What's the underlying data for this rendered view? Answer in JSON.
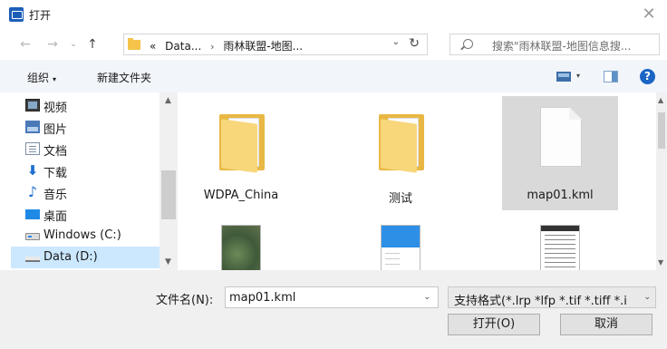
{
  "window": {
    "title": "打开",
    "icon": "app-dialog-icon",
    "close_label": "✕"
  },
  "nav": {
    "back_label": "←",
    "forward_label": "→",
    "history_label": "⌄",
    "up_label": "↑"
  },
  "address": {
    "prefix": "«",
    "crumb1": "Data...",
    "separator": "›",
    "crumb2": "雨林联盟-地图...",
    "dropdown_label": "⌄",
    "refresh_label": "↻"
  },
  "search": {
    "placeholder": "搜索\"雨林联盟-地图信息搜..."
  },
  "toolbar": {
    "organize_label": "组织",
    "organize_caret": "▾",
    "new_folder_label": "新建文件夹",
    "view_caret": "▾",
    "help_label": "?"
  },
  "sidebar": {
    "items": [
      {
        "label": "视频",
        "icon": "video-icon"
      },
      {
        "label": "图片",
        "icon": "pictures-icon"
      },
      {
        "label": "文档",
        "icon": "documents-icon"
      },
      {
        "label": "下载",
        "icon": "download-icon"
      },
      {
        "label": "音乐",
        "icon": "music-icon"
      },
      {
        "label": "桌面",
        "icon": "desktop-icon"
      },
      {
        "label": "Windows (C:)",
        "icon": "drive-icon"
      },
      {
        "label": "Data (D:)",
        "icon": "drive-icon"
      }
    ],
    "selected_index": 7
  },
  "files": {
    "items": [
      {
        "name": "WDPA_China",
        "type": "folder"
      },
      {
        "name": "测试",
        "type": "folder"
      },
      {
        "name": "map01.kml",
        "type": "file"
      },
      {
        "name": "",
        "type": "image-map"
      },
      {
        "name": "",
        "type": "image-app"
      },
      {
        "name": "",
        "type": "image-list"
      }
    ],
    "selected_index": 2
  },
  "bottom": {
    "filename_label": "文件名(N):",
    "filename_value": "map01.kml",
    "filetype_value": "支持格式(*.lrp *lfp *.tif *.tiff *.i",
    "open_label": "打开(O)",
    "cancel_label": "取消"
  },
  "colors": {
    "accent": "#1b65c5",
    "selected_bg": "#cce8ff",
    "folder": "#f5c34a",
    "toolbar_bg": "#f2f5fa",
    "bottom_bg": "#f0f0f0"
  }
}
